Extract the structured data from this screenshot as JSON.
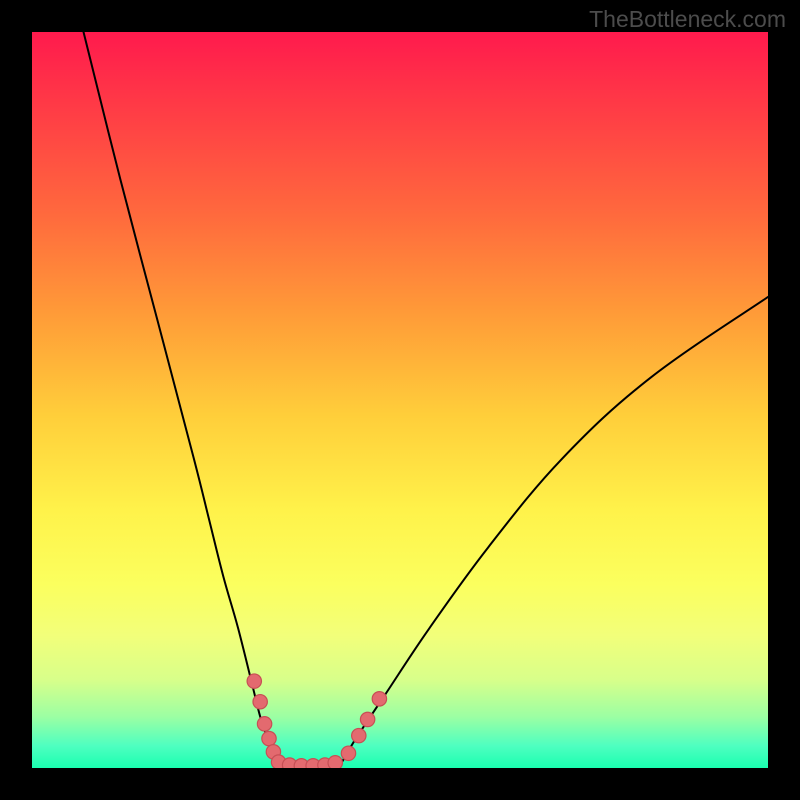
{
  "watermark_text": "TheBottleneck.com",
  "chart_data": {
    "type": "line",
    "title": "",
    "xlabel": "",
    "ylabel": "",
    "xlim": [
      0,
      100
    ],
    "ylim": [
      0,
      100
    ],
    "grid": false,
    "legend": false,
    "background_gradient": {
      "direction": "top-to-bottom",
      "stops": [
        {
          "pos": 0,
          "color": "#ff1a4d"
        },
        {
          "pos": 25,
          "color": "#ff6a3d"
        },
        {
          "pos": 52,
          "color": "#ffce3a"
        },
        {
          "pos": 75,
          "color": "#f7ff68"
        },
        {
          "pos": 93,
          "color": "#8cffa0"
        },
        {
          "pos": 100,
          "color": "#1affb0"
        }
      ]
    },
    "series": [
      {
        "name": "left-curve",
        "x": [
          7,
          12,
          17,
          22,
          24,
          26,
          28,
          30,
          31,
          32,
          33,
          33.7
        ],
        "y": [
          100,
          80,
          61,
          42,
          34,
          26,
          19,
          11,
          7,
          4,
          1.5,
          0
        ]
      },
      {
        "name": "valley-floor",
        "x": [
          33.7,
          36,
          38,
          40,
          41.5
        ],
        "y": [
          0,
          0,
          0,
          0,
          0
        ]
      },
      {
        "name": "right-curve",
        "x": [
          41.5,
          44,
          48,
          54,
          62,
          72,
          84,
          100
        ],
        "y": [
          0,
          4,
          10,
          19,
          30,
          42,
          53,
          64
        ]
      }
    ],
    "markers": {
      "name": "red-dots",
      "color": "#e36a6f",
      "points": [
        {
          "x": 30.2,
          "y": 11.8
        },
        {
          "x": 31.0,
          "y": 9.0
        },
        {
          "x": 31.6,
          "y": 6.0
        },
        {
          "x": 32.2,
          "y": 4.0
        },
        {
          "x": 32.8,
          "y": 2.2
        },
        {
          "x": 33.5,
          "y": 0.8
        },
        {
          "x": 35.0,
          "y": 0.4
        },
        {
          "x": 36.6,
          "y": 0.3
        },
        {
          "x": 38.2,
          "y": 0.3
        },
        {
          "x": 39.8,
          "y": 0.4
        },
        {
          "x": 41.2,
          "y": 0.7
        },
        {
          "x": 43.0,
          "y": 2.0
        },
        {
          "x": 44.4,
          "y": 4.4
        },
        {
          "x": 45.6,
          "y": 6.6
        },
        {
          "x": 47.2,
          "y": 9.4
        }
      ]
    }
  }
}
